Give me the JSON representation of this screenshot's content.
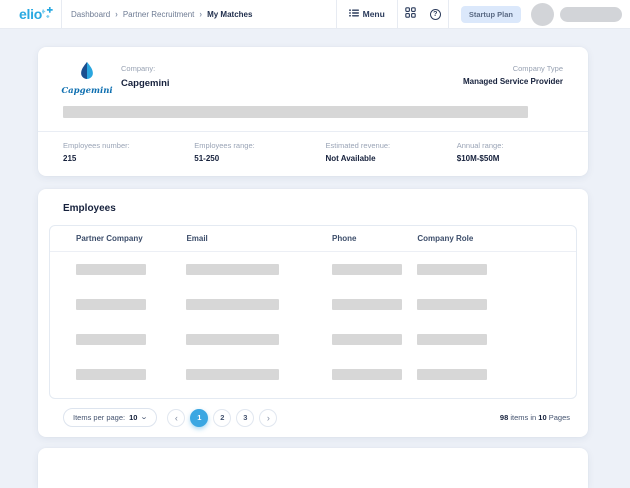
{
  "header": {
    "logo_text": "elio",
    "breadcrumb": {
      "items": [
        "Dashboard",
        "Partner Recruitment",
        "My Matches"
      ],
      "separator": "›"
    },
    "menu_label": "Menu",
    "help_glyph": "?",
    "plan_badge": "Startup Plan"
  },
  "company_card": {
    "logo_script": "Capgemini",
    "company_label": "Company:",
    "company_name": "Capgemini",
    "company_type_label": "Company Type",
    "company_type_value": "Managed Service Provider",
    "stats": [
      {
        "label": "Employees number:",
        "value": "215"
      },
      {
        "label": "Employees range:",
        "value": "51-250"
      },
      {
        "label": "Estimated revenue:",
        "value": "Not Available"
      },
      {
        "label": "Annual range:",
        "value": "$10M-$50M"
      }
    ]
  },
  "employees_card": {
    "title": "Employees",
    "columns": [
      "Partner Company",
      "Email",
      "Phone",
      "Company Role"
    ],
    "skeleton_rows": 4,
    "pagination": {
      "items_per_page_label": "Items per page:",
      "items_per_page_value": "10",
      "prev_glyph": "‹",
      "next_glyph": "›",
      "pages": [
        "1",
        "2",
        "3"
      ],
      "active_page": "1",
      "summary_count": "98",
      "summary_mid": "items in",
      "summary_pages": "10",
      "summary_suffix": "Pages"
    }
  },
  "colors": {
    "brand_blue": "#29a9e1",
    "active_page_blue": "#3ba7e2",
    "capgemini_blue": "#0e6fb0",
    "page_background": "#edf1f8",
    "skeleton_gray": "#d7d7d7",
    "badge_background": "#dbe8fb"
  }
}
